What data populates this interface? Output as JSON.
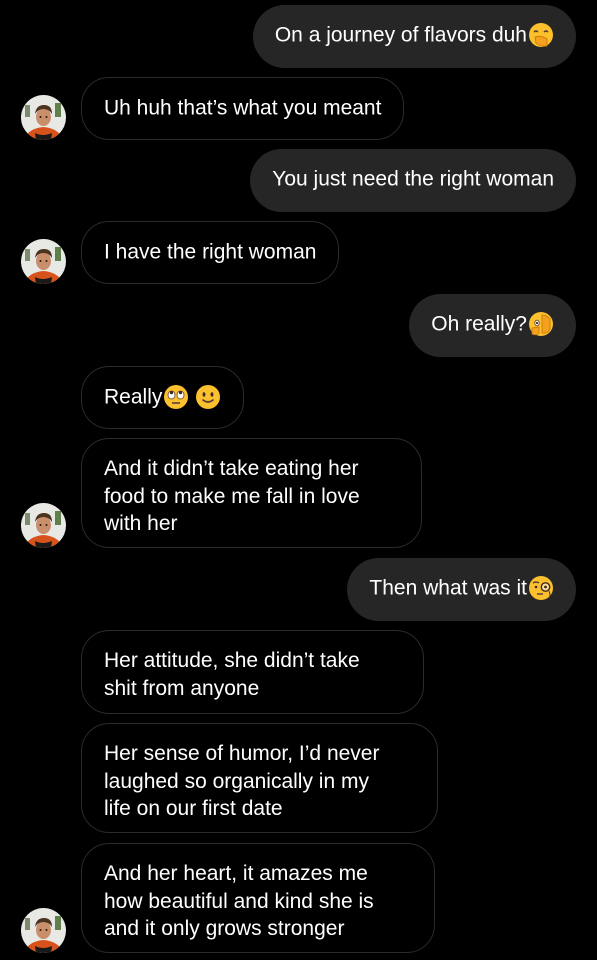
{
  "conversation": {
    "messages": [
      {
        "sender": "me",
        "text": "On a journey of flavors duh",
        "emojis": [
          "hand-over-mouth-emoji"
        ]
      },
      {
        "sender": "other",
        "text": "Uh huh that’s what you meant"
      },
      {
        "sender": "me",
        "text": "You just need the right woman"
      },
      {
        "sender": "other",
        "text": "I have the right woman"
      },
      {
        "sender": "me",
        "text": "Oh really?",
        "emojis": [
          "peeking-eye-emoji"
        ]
      },
      {
        "sender": "other",
        "text": "Really",
        "emojis": [
          "eye-roll-emoji",
          "slight-smile-emoji"
        ]
      },
      {
        "sender": "other",
        "lines": [
          "And it didn’t take eating her",
          "food to make me fall in love",
          "with her"
        ]
      },
      {
        "sender": "me",
        "text": "Then what was it",
        "emojis": [
          "monocle-emoji"
        ]
      },
      {
        "sender": "other",
        "lines": [
          "Her attitude, she didn’t take",
          "shit from anyone"
        ]
      },
      {
        "sender": "other",
        "lines": [
          "Her sense of humor, I’d never",
          "laughed so organically in my",
          "life on our first date"
        ]
      },
      {
        "sender": "other",
        "lines": [
          "And her heart, it amazes me",
          "how beautiful and kind she is",
          "and it only grows stronger"
        ]
      }
    ],
    "avatar_icon": "contact-avatar-icon"
  },
  "colors": {
    "background": "#000000",
    "outgoing_bubble": "#262626",
    "incoming_border": "#2b2b2b",
    "text": "#ffffff"
  }
}
